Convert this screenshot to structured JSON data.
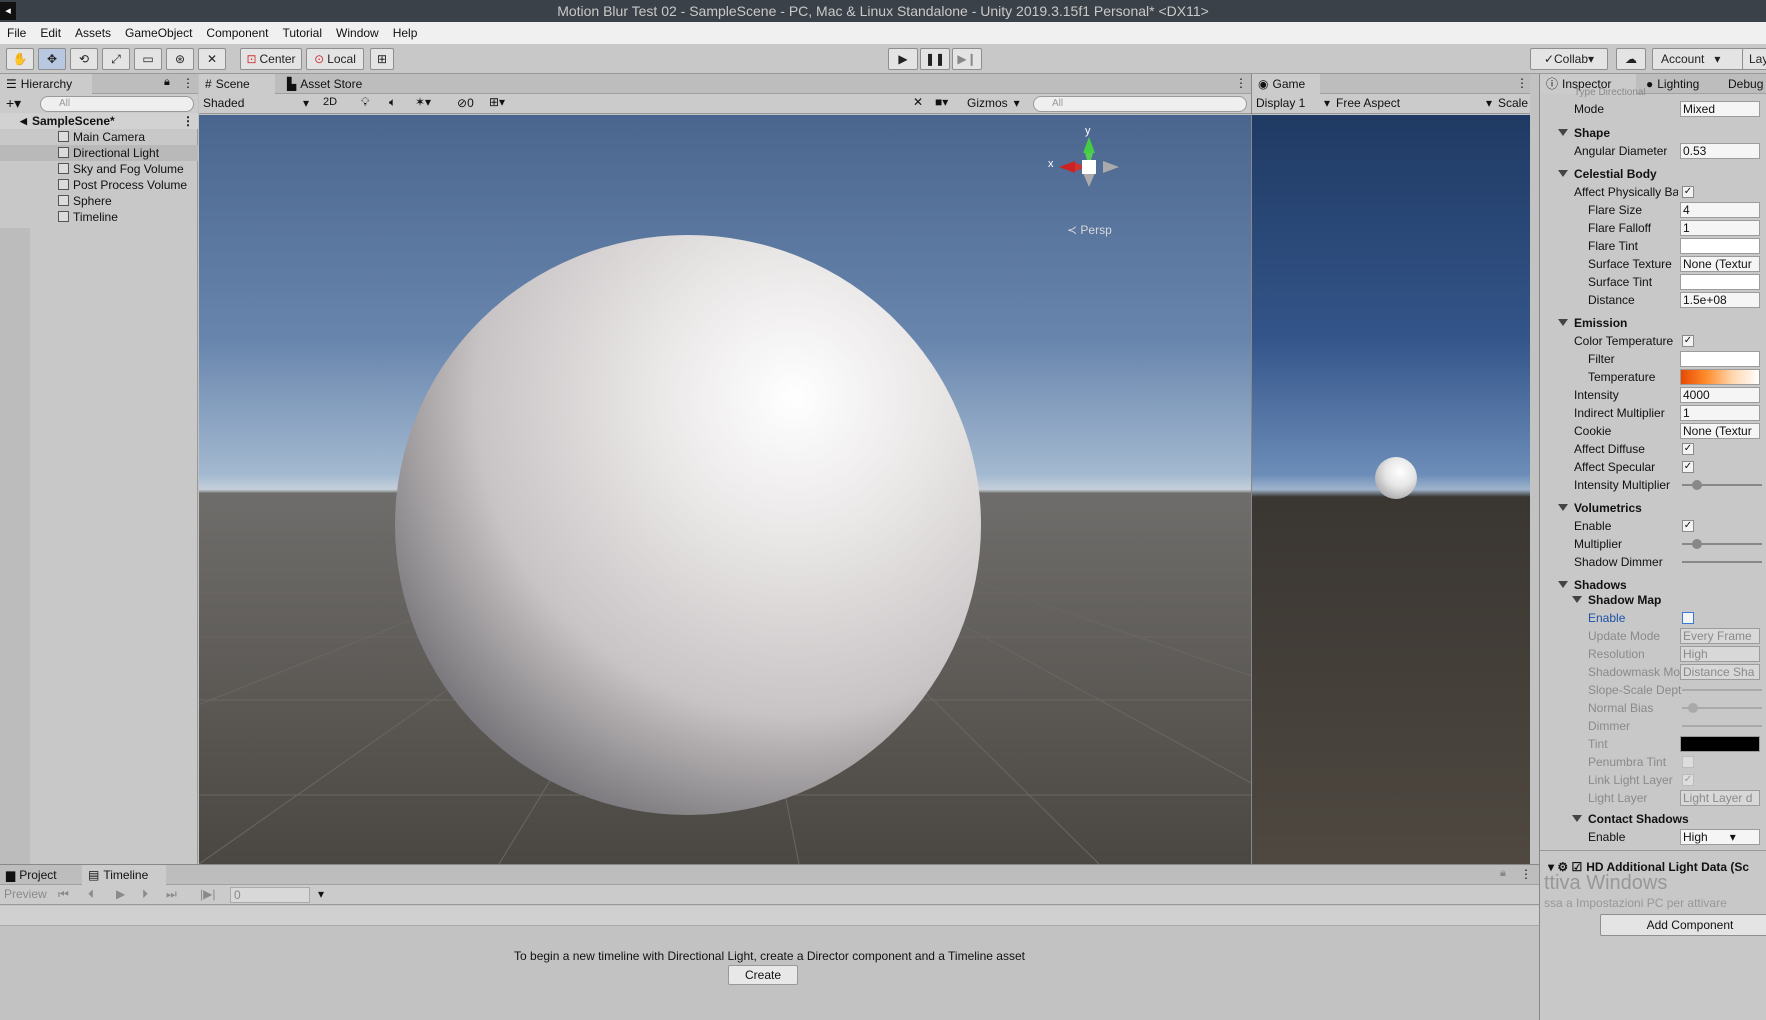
{
  "window_title": "Motion Blur Test 02 - SampleScene - PC, Mac & Linux Standalone - Unity 2019.3.15f1 Personal* <DX11>",
  "menu": [
    "File",
    "Edit",
    "Assets",
    "GameObject",
    "Component",
    "Tutorial",
    "Window",
    "Help"
  ],
  "toolbar": {
    "center": "Center",
    "local": "Local",
    "collab": "Collab",
    "account": "Account",
    "layers": "Lay"
  },
  "hierarchy": {
    "tab": "Hierarchy",
    "search": "All",
    "scene": "SampleScene*",
    "items": [
      "Main Camera",
      "Directional Light",
      "Sky and Fog Volume",
      "Post Process Volume",
      "Sphere",
      "Timeline"
    ]
  },
  "scene": {
    "tabs": [
      "Scene",
      "Asset Store"
    ],
    "shading": "Shaded",
    "mode2d": "2D",
    "hidden": "0",
    "gizmos": "Gizmos",
    "search": "All",
    "persp": "Persp",
    "axis_x": "x",
    "axis_y": "y"
  },
  "game": {
    "tab": "Game",
    "display": "Display 1",
    "aspect": "Free Aspect",
    "scale": "Scale"
  },
  "inspector": {
    "tabs": [
      "Inspector",
      "Lighting",
      "Debug"
    ],
    "partial_top": "Type     Directional",
    "mode_label": "Mode",
    "mode_value": "Mixed",
    "shape": {
      "title": "Shape",
      "angular_label": "Angular Diameter",
      "angular_value": "0.53"
    },
    "celestial": {
      "title": "Celestial Body",
      "rows": [
        {
          "label": "Affect Physically Bas",
          "value": "✓"
        },
        {
          "label": "Flare Size",
          "value": "4"
        },
        {
          "label": "Flare Falloff",
          "value": "1"
        },
        {
          "label": "Flare Tint",
          "value": ""
        },
        {
          "label": "Surface Texture",
          "value": "None (Textur"
        },
        {
          "label": "Surface Tint",
          "value": ""
        },
        {
          "label": "Distance",
          "value": "1.5e+08"
        }
      ]
    },
    "emission": {
      "title": "Emission",
      "rows": [
        {
          "label": "Color Temperature",
          "value": "✓"
        },
        {
          "label": "Filter",
          "value": ""
        },
        {
          "label": "Temperature",
          "value": ""
        },
        {
          "label": "Intensity",
          "value": "4000"
        },
        {
          "label": "Indirect Multiplier",
          "value": "1"
        },
        {
          "label": "Cookie",
          "value": "None (Textur"
        },
        {
          "label": "Affect Diffuse",
          "value": "✓"
        },
        {
          "label": "Affect Specular",
          "value": "✓"
        },
        {
          "label": "Intensity Multiplier",
          "value": ""
        }
      ]
    },
    "volumetrics": {
      "title": "Volumetrics",
      "rows": [
        {
          "label": "Enable",
          "value": "✓"
        },
        {
          "label": "Multiplier",
          "value": ""
        },
        {
          "label": "Shadow Dimmer",
          "value": ""
        }
      ]
    },
    "shadows": {
      "title": "Shadows",
      "shadow_map": "Shadow Map",
      "rows": [
        {
          "label": "Enable",
          "value": ""
        },
        {
          "label": "Update Mode",
          "value": "Every Frame"
        },
        {
          "label": "Resolution",
          "value": "High"
        },
        {
          "label": "Shadowmask Moc",
          "value": "Distance Sha"
        },
        {
          "label": "Slope-Scale Dept",
          "value": ""
        },
        {
          "label": "Normal Bias",
          "value": ""
        },
        {
          "label": "Dimmer",
          "value": ""
        },
        {
          "label": "Tint",
          "value": ""
        },
        {
          "label": "Penumbra Tint",
          "value": ""
        },
        {
          "label": "Link Light Layer",
          "value": "✓"
        },
        {
          "label": "Light Layer",
          "value": "Light Layer d"
        }
      ],
      "contact": "Contact Shadows",
      "contact_enable": "Enable",
      "contact_value": "High"
    },
    "component": "HD Additional Light Data (Sc",
    "add_component": "Add Component",
    "watermark1": "ttiva Windows",
    "watermark2": "ssa a Impostazioni PC per attivare"
  },
  "bottom": {
    "tabs": [
      "Project",
      "Timeline"
    ],
    "preview": "Preview",
    "frame": "0",
    "message": "To begin a new timeline with Directional Light, create a Director component and a Timeline asset",
    "create": "Create"
  }
}
